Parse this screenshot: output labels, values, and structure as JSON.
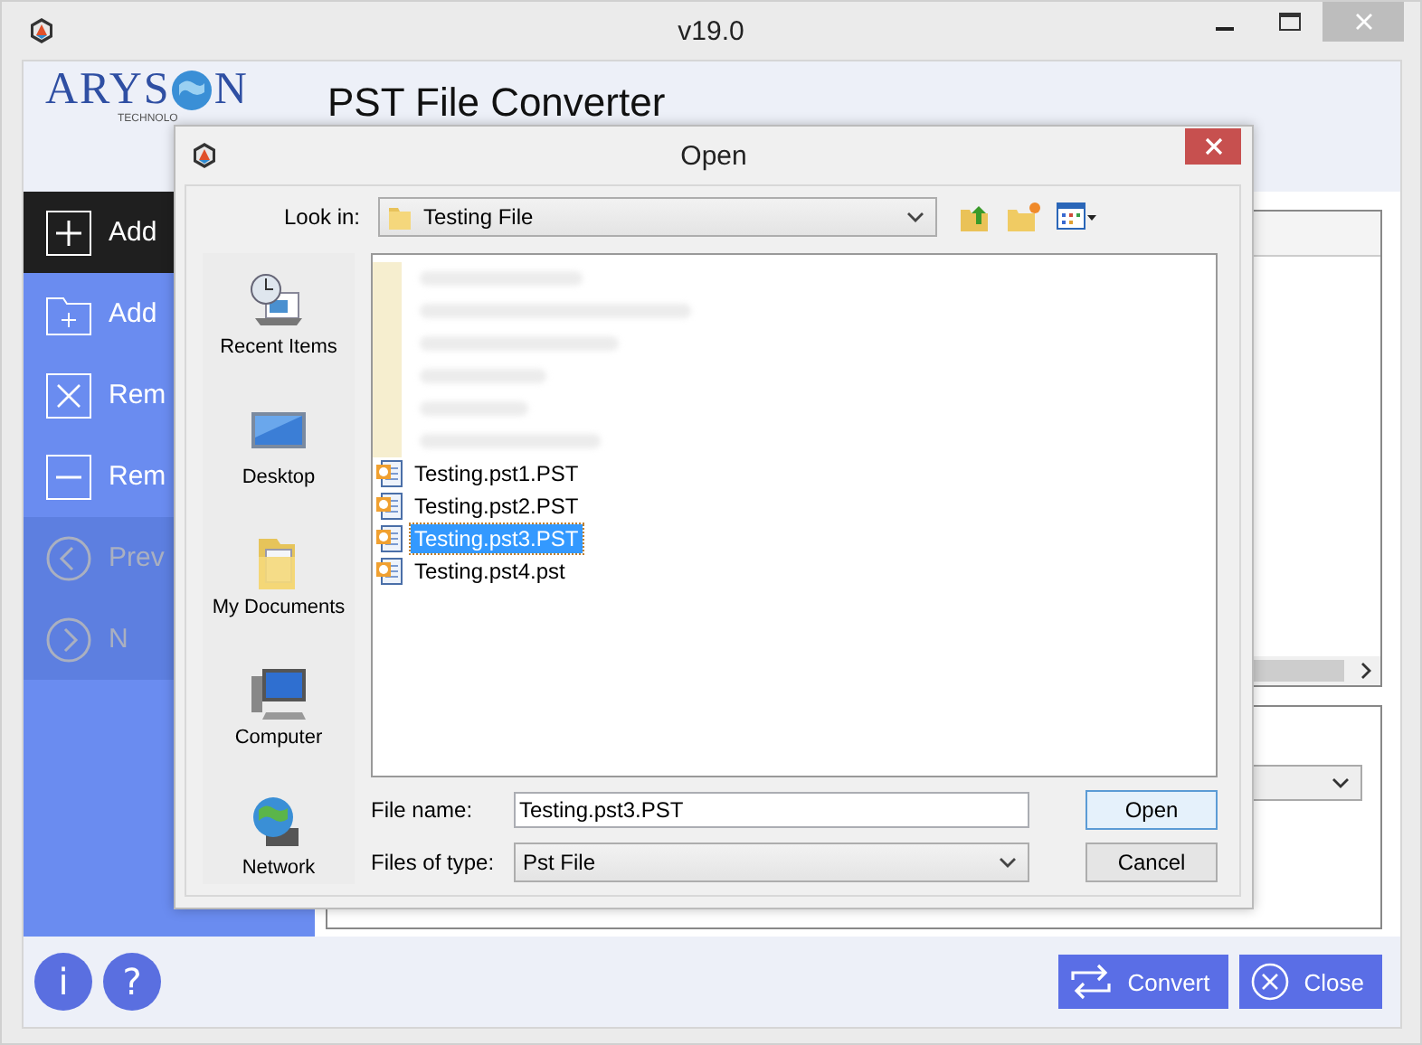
{
  "window": {
    "title": "v19.0"
  },
  "app": {
    "title": "PST File Converter",
    "logo": {
      "left": "ARYS",
      "right": "N",
      "tagline": "TECHNOLO"
    }
  },
  "sidebar": {
    "items": [
      {
        "label": "Add",
        "kind": "plus",
        "selected": true,
        "disabled": false
      },
      {
        "label": "Add",
        "kind": "folder",
        "selected": false,
        "disabled": false
      },
      {
        "label": "Rem",
        "kind": "cross",
        "selected": false,
        "disabled": false
      },
      {
        "label": "Rem",
        "kind": "minus",
        "selected": false,
        "disabled": false
      },
      {
        "label": "Prev",
        "kind": "back",
        "selected": false,
        "disabled": true
      },
      {
        "label": "N",
        "kind": "next",
        "selected": false,
        "disabled": true
      }
    ]
  },
  "dialog": {
    "title": "Open",
    "look_in": {
      "label": "Look in:",
      "value": "Testing File"
    },
    "places": [
      {
        "label": "Recent Items",
        "kind": "recent"
      },
      {
        "label": "Desktop",
        "kind": "desktop"
      },
      {
        "label": "My Documents",
        "kind": "documents"
      },
      {
        "label": "Computer",
        "kind": "computer"
      },
      {
        "label": "Network",
        "kind": "network"
      }
    ],
    "files": [
      {
        "kind": "blurred"
      },
      {
        "kind": "blurred"
      },
      {
        "kind": "blurred"
      },
      {
        "kind": "blurred"
      },
      {
        "kind": "blurred"
      },
      {
        "kind": "blurred"
      },
      {
        "kind": "file",
        "name": "Testing.pst1.PST",
        "selected": false
      },
      {
        "kind": "file",
        "name": "Testing.pst2.PST",
        "selected": false
      },
      {
        "kind": "file",
        "name": "Testing.pst3.PST",
        "selected": true
      },
      {
        "kind": "file",
        "name": "Testing.pst4.pst",
        "selected": false
      }
    ],
    "file_name": {
      "label": "File name:",
      "value": "Testing.pst3.PST"
    },
    "file_type": {
      "label": "Files of type:",
      "value": "Pst File"
    },
    "buttons": [
      {
        "label": "Open",
        "kind": "default"
      },
      {
        "label": "Cancel",
        "kind": "normal"
      }
    ]
  },
  "footer": {
    "round_buttons": [
      {
        "glyph": "i"
      },
      {
        "glyph": "?"
      }
    ],
    "buttons": [
      {
        "label": "Convert",
        "kind": "convert"
      },
      {
        "label": "Close",
        "kind": "close"
      }
    ]
  }
}
